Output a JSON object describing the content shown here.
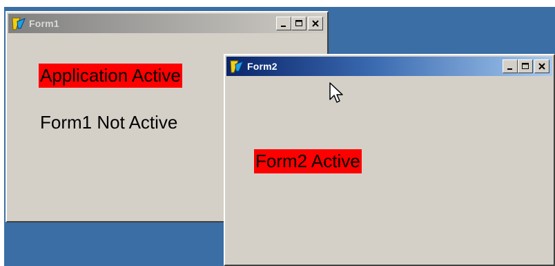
{
  "form1": {
    "title": "Form1",
    "labels": {
      "app_status": "Application Active",
      "form_status": "Form1 Not Active"
    }
  },
  "form2": {
    "title": "Form2",
    "labels": {
      "form_status": "Form2 Active"
    }
  },
  "caption_buttons": [
    "minimize",
    "maximize",
    "close"
  ],
  "colors": {
    "desktop": "#3a6ea5",
    "window_face": "#d4d0c8",
    "active_label_bg": "#ff0000",
    "active_titlebar_start": "#0a246a",
    "active_titlebar_end": "#a6caf0",
    "inactive_titlebar_start": "#808080",
    "inactive_titlebar_end": "#cfccc6"
  },
  "icons": {
    "app": "delphi-app-icon",
    "cursor": "mouse-pointer-icon"
  }
}
